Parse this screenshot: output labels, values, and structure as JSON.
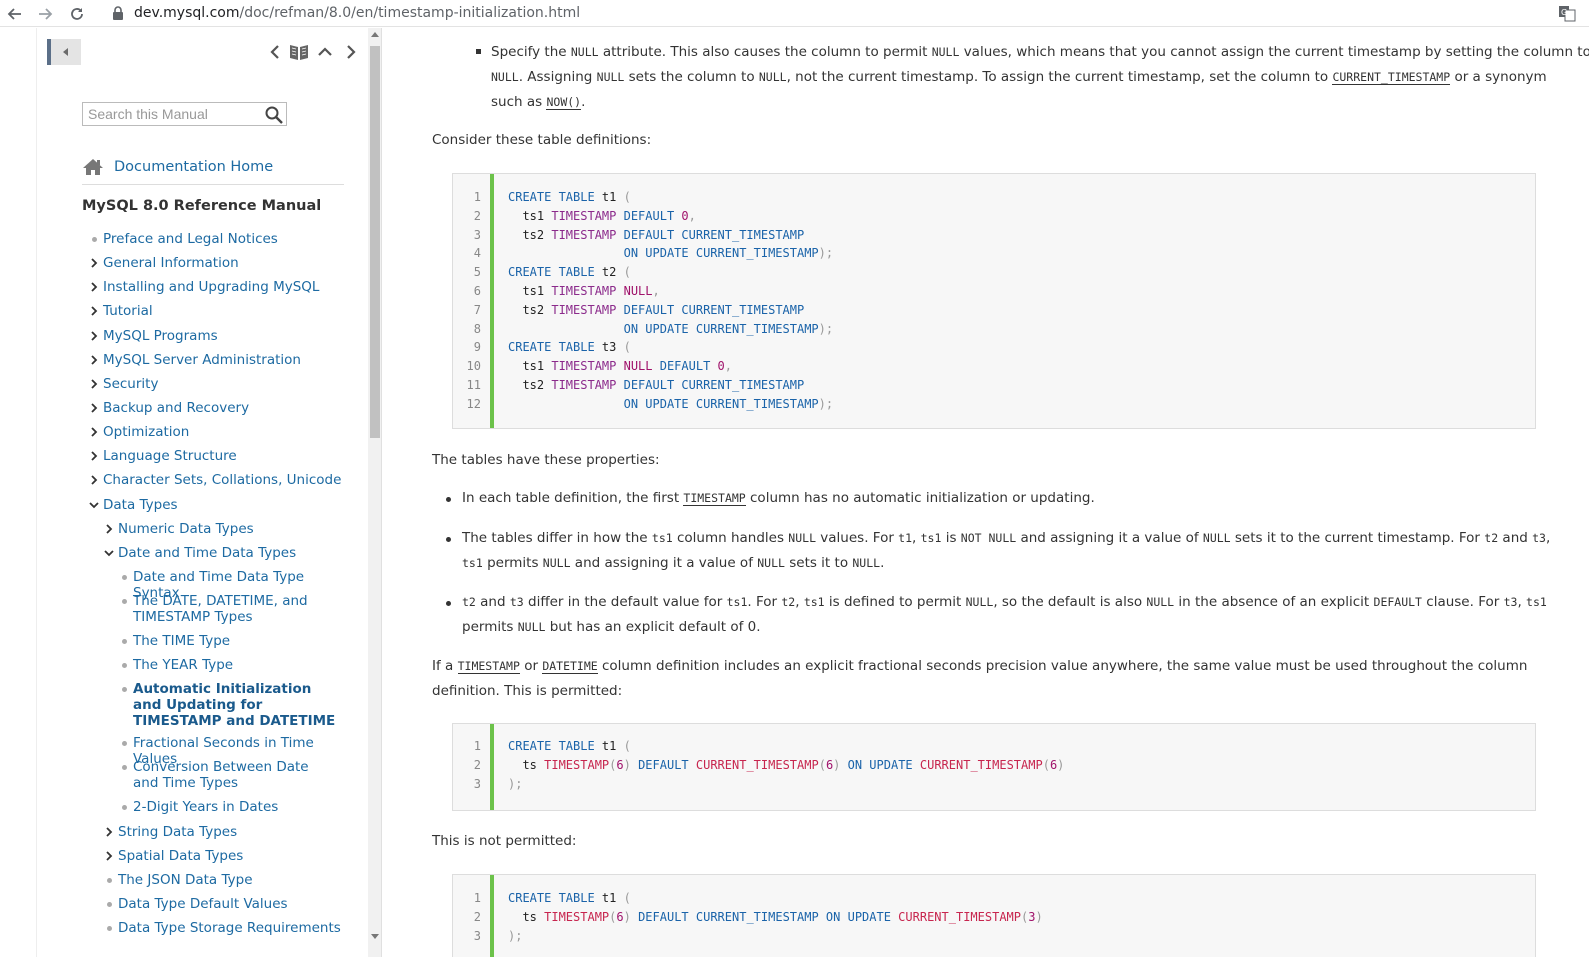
{
  "browser": {
    "url_host": "dev.mysql.com",
    "url_path": "/doc/refman/8.0/en/timestamp-initialization.html"
  },
  "sidebar": {
    "search_placeholder": "Search this Manual",
    "doc_home": "Documentation Home",
    "manual_title": "MySQL 8.0 Reference Manual",
    "toc": [
      {
        "label": "Preface and Legal Notices",
        "marker": "bullet",
        "level": 0
      },
      {
        "label": "General Information",
        "marker": "chevron-right",
        "level": 0
      },
      {
        "label": "Installing and Upgrading MySQL",
        "marker": "chevron-right",
        "level": 0
      },
      {
        "label": "Tutorial",
        "marker": "chevron-right",
        "level": 0
      },
      {
        "label": "MySQL Programs",
        "marker": "chevron-right",
        "level": 0
      },
      {
        "label": "MySQL Server Administration",
        "marker": "chevron-right",
        "level": 0
      },
      {
        "label": "Security",
        "marker": "chevron-right",
        "level": 0
      },
      {
        "label": "Backup and Recovery",
        "marker": "chevron-right",
        "level": 0
      },
      {
        "label": "Optimization",
        "marker": "chevron-right",
        "level": 0
      },
      {
        "label": "Language Structure",
        "marker": "chevron-right",
        "level": 0
      },
      {
        "label": "Character Sets, Collations, Unicode",
        "marker": "chevron-right",
        "level": 0
      },
      {
        "label": "Data Types",
        "marker": "chevron-down",
        "level": 0
      },
      {
        "label": "Numeric Data Types",
        "marker": "chevron-right",
        "level": 1
      },
      {
        "label": "Date and Time Data Types",
        "marker": "chevron-down",
        "level": 1
      },
      {
        "label": "Date and Time Data Type Syntax",
        "marker": "bullet",
        "level": 2
      },
      {
        "label": "The DATE, DATETIME, and TIMESTAMP Types",
        "marker": "bullet",
        "level": 2
      },
      {
        "label": "The TIME Type",
        "marker": "bullet",
        "level": 2
      },
      {
        "label": "The YEAR Type",
        "marker": "bullet",
        "level": 2
      },
      {
        "label": "Automatic Initialization and Updating for TIMESTAMP and DATETIME",
        "marker": "bullet",
        "level": 2,
        "active": true
      },
      {
        "label": "Fractional Seconds in Time Values",
        "marker": "bullet",
        "level": 2
      },
      {
        "label": "Conversion Between Date and Time Types",
        "marker": "bullet",
        "level": 2
      },
      {
        "label": "2-Digit Years in Dates",
        "marker": "bullet",
        "level": 2
      },
      {
        "label": "String Data Types",
        "marker": "chevron-right",
        "level": 1
      },
      {
        "label": "Spatial Data Types",
        "marker": "chevron-right",
        "level": 1
      },
      {
        "label": "The JSON Data Type",
        "marker": "bullet",
        "level": 1
      },
      {
        "label": "Data Type Default Values",
        "marker": "bullet",
        "level": 1
      },
      {
        "label": "Data Type Storage Requirements",
        "marker": "bullet",
        "level": 1
      }
    ]
  },
  "content": {
    "null_bullet": {
      "a": "Specify the ",
      "b": " attribute. This also causes the column to permit ",
      "c": " values, which means that you cannot assign the current timestamp by setting the column to",
      "d": ". Assigning ",
      "e": " sets the column to ",
      "f": ", not the current timestamp. To assign the current timestamp, set the column to ",
      "g": " or a synonym",
      "h": "such as ",
      "i": ".",
      "null": "NULL",
      "current_timestamp": "CURRENT_TIMESTAMP",
      "now": "NOW()"
    },
    "consider": "Consider these table definitions:",
    "properties": "The tables have these properties:",
    "prop1": {
      "a": "In each table definition, the first ",
      "code": "TIMESTAMP",
      "b": " column has no automatic initialization or updating."
    },
    "prop2": {
      "a": "The tables differ in how the ",
      "ts1": "ts1",
      "b": " column handles ",
      "null": "NULL",
      "c": " values. For ",
      "t1": "t1",
      "comma": ", ",
      "d": " is ",
      "notnull": "NOT NULL",
      "e": " and assigning it a value of ",
      "f": " sets it to the current timestamp. For ",
      "t2": "t2",
      "and": " and ",
      "t3": "t3",
      "g": "permits ",
      "h": " and assigning it a value of ",
      "i": " sets it to ",
      "end": "."
    },
    "prop3": {
      "t2": "t2",
      "and": " and ",
      "t3": "t3",
      "a": " differ in the default value for ",
      "ts1": "ts1",
      "b": ". For ",
      "comma": ", ",
      "c": " is defined to permit ",
      "null": "NULL",
      "d": ", so the default is also ",
      "e": " in the absence of an explicit ",
      "default": "DEFAULT",
      "f": " clause. For ",
      "g": "permits ",
      "h": " but has an explicit default of 0."
    },
    "fsp": {
      "a": "If a ",
      "timestamp": "TIMESTAMP",
      "or": " or ",
      "datetime": "DATETIME",
      "b": " column definition includes an explicit fractional seconds precision value anywhere, the same value must be used throughout the column",
      "c": "definition. This is permitted:"
    },
    "not_permitted": "This is not permitted:"
  },
  "code1": [
    [
      [
        "kw",
        "CREATE TABLE "
      ],
      [
        "id",
        "t1"
      ],
      [
        "pu",
        " ("
      ]
    ],
    [
      [
        "id",
        "  ts1 "
      ],
      [
        "ty",
        "TIMESTAMP "
      ],
      [
        "kw",
        "DEFAULT "
      ],
      [
        "nm",
        "0"
      ],
      [
        "pu",
        ","
      ]
    ],
    [
      [
        "id",
        "  ts2 "
      ],
      [
        "ty",
        "TIMESTAMP "
      ],
      [
        "kw",
        "DEFAULT CURRENT_TIMESTAMP"
      ]
    ],
    [
      [
        "kw",
        "                ON UPDATE CURRENT_TIMESTAMP"
      ],
      [
        "pu",
        ");"
      ]
    ],
    [
      [
        "kw",
        "CREATE TABLE "
      ],
      [
        "id",
        "t2"
      ],
      [
        "pu",
        " ("
      ]
    ],
    [
      [
        "id",
        "  ts1 "
      ],
      [
        "ty",
        "TIMESTAMP "
      ],
      [
        "nm",
        "NULL"
      ],
      [
        "pu",
        ","
      ]
    ],
    [
      [
        "id",
        "  ts2 "
      ],
      [
        "ty",
        "TIMESTAMP "
      ],
      [
        "kw",
        "DEFAULT CURRENT_TIMESTAMP"
      ]
    ],
    [
      [
        "kw",
        "                ON UPDATE CURRENT_TIMESTAMP"
      ],
      [
        "pu",
        ");"
      ]
    ],
    [
      [
        "kw",
        "CREATE TABLE "
      ],
      [
        "id",
        "t3"
      ],
      [
        "pu",
        " ("
      ]
    ],
    [
      [
        "id",
        "  ts1 "
      ],
      [
        "ty",
        "TIMESTAMP "
      ],
      [
        "nm",
        "NULL "
      ],
      [
        "kw",
        "DEFAULT "
      ],
      [
        "nm",
        "0"
      ],
      [
        "pu",
        ","
      ]
    ],
    [
      [
        "id",
        "  ts2 "
      ],
      [
        "ty",
        "TIMESTAMP "
      ],
      [
        "kw",
        "DEFAULT CURRENT_TIMESTAMP"
      ]
    ],
    [
      [
        "kw",
        "                ON UPDATE CURRENT_TIMESTAMP"
      ],
      [
        "pu",
        ");"
      ]
    ]
  ],
  "code2": [
    [
      [
        "kw",
        "CREATE TABLE "
      ],
      [
        "id",
        "t1"
      ],
      [
        "pu",
        " ("
      ]
    ],
    [
      [
        "id",
        "  ts "
      ],
      [
        "fn",
        "TIMESTAMP"
      ],
      [
        "pu",
        "("
      ],
      [
        "nm",
        "6"
      ],
      [
        "pu",
        ") "
      ],
      [
        "kw",
        "DEFAULT "
      ],
      [
        "fn",
        "CURRENT_TIMESTAMP"
      ],
      [
        "pu",
        "("
      ],
      [
        "nm",
        "6"
      ],
      [
        "pu",
        ") "
      ],
      [
        "kw",
        "ON UPDATE "
      ],
      [
        "fn",
        "CURRENT_TIMESTAMP"
      ],
      [
        "pu",
        "("
      ],
      [
        "nm",
        "6"
      ],
      [
        "pu",
        ")"
      ]
    ],
    [
      [
        "pu",
        ");"
      ]
    ]
  ],
  "code3": [
    [
      [
        "kw",
        "CREATE TABLE "
      ],
      [
        "id",
        "t1"
      ],
      [
        "pu",
        " ("
      ]
    ],
    [
      [
        "id",
        "  ts "
      ],
      [
        "fn",
        "TIMESTAMP"
      ],
      [
        "pu",
        "("
      ],
      [
        "nm",
        "6"
      ],
      [
        "pu",
        ") "
      ],
      [
        "kw",
        "DEFAULT CURRENT_TIMESTAMP ON UPDATE "
      ],
      [
        "fn",
        "CURRENT_TIMESTAMP"
      ],
      [
        "pu",
        "("
      ],
      [
        "nm",
        "3"
      ],
      [
        "pu",
        ")"
      ]
    ],
    [
      [
        "pu",
        ");"
      ]
    ]
  ]
}
